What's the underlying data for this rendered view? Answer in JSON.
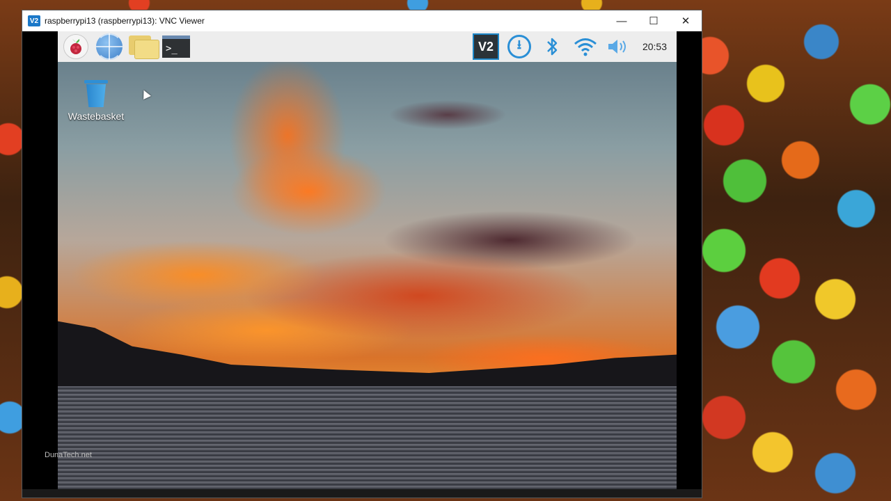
{
  "window": {
    "title": "raspberrypi13 (raspberrypi13): VNC Viewer",
    "logo_text": "V2",
    "minimize": "—",
    "maximize": "☐",
    "close": "✕"
  },
  "taskbar": {
    "launchers": [
      "raspberry-menu",
      "web-browser",
      "file-manager",
      "terminal"
    ],
    "terminal_prompt": ">_",
    "tray": [
      "vnc-server",
      "updates",
      "bluetooth",
      "wifi",
      "volume"
    ],
    "vnc_tray_text": "V2",
    "clock": "20:53"
  },
  "desktop": {
    "icons": [
      {
        "label": "Wastebasket",
        "icon": "trash-icon"
      }
    ]
  },
  "watermark": "DunaTech.net",
  "colors": {
    "accent": "#2a8fd6",
    "taskbar_bg": "#ededed",
    "titlebar_bg": "#ffffff"
  }
}
